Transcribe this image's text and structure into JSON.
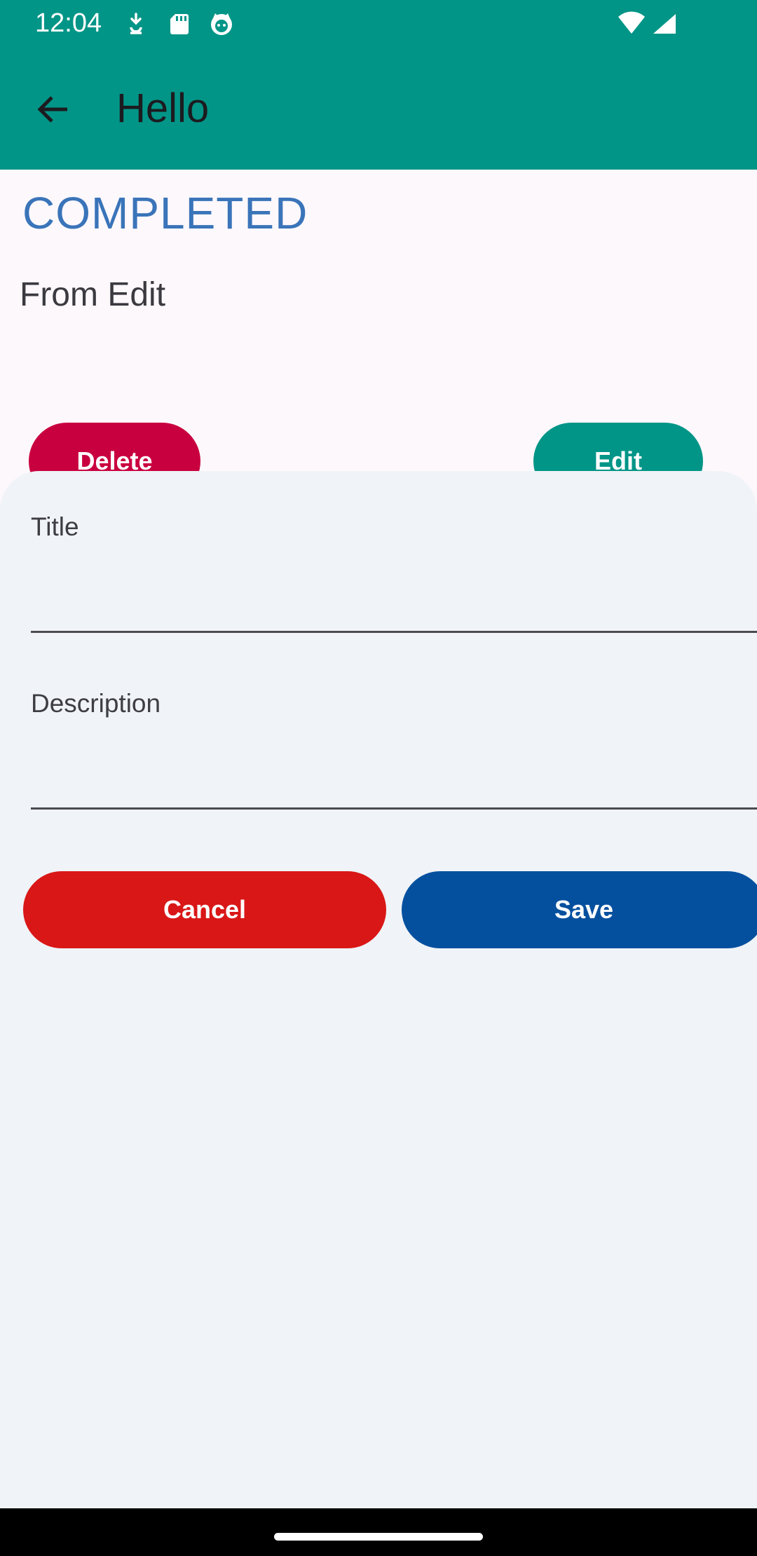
{
  "status_bar": {
    "time": "12:04",
    "icons": [
      "download-notification-icon",
      "sd-card-icon",
      "cat-face-icon",
      "wifi-icon",
      "cell-signal-icon"
    ]
  },
  "app_bar": {
    "title": "Hello",
    "back_icon": "arrow-back-icon",
    "color": "#019587"
  },
  "todo": {
    "status": "COMPLETED",
    "description": "From Edit",
    "delete_label": "Delete",
    "edit_label": "Edit"
  },
  "edit_sheet": {
    "title_label": "Title",
    "title_value": "",
    "description_label": "Description",
    "description_value": "",
    "cancel_label": "Cancel",
    "save_label": "Save"
  },
  "colors": {
    "teal": "#019587",
    "status_blue": "#3a74b9",
    "delete_red": "#c9003f",
    "cancel_red": "#d91717",
    "save_blue": "#04509f",
    "sheet_bg": "#f0f3f7"
  }
}
